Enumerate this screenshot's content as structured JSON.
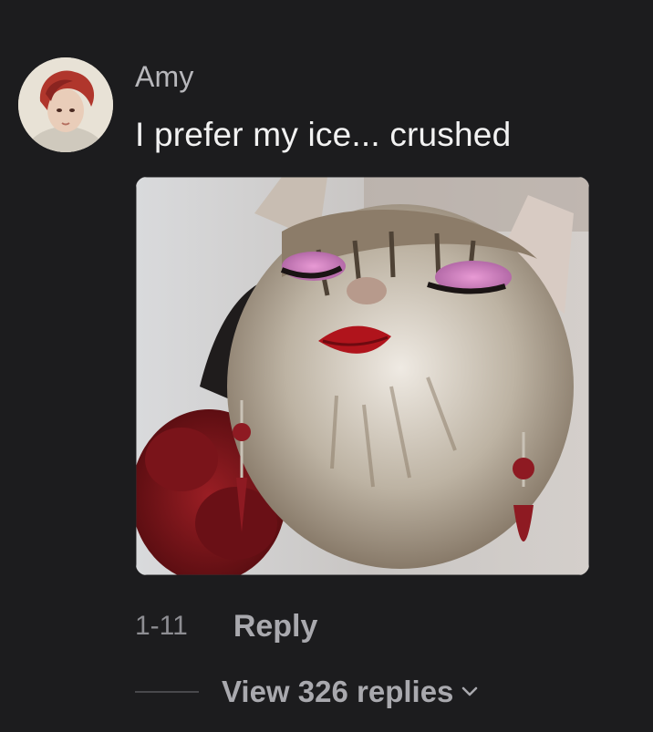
{
  "comment": {
    "username": "Amy",
    "text": "I prefer my ice... crushed",
    "date": "1-11",
    "reply_label": "Reply",
    "view_replies_label": "View 326 replies",
    "avatar_icon": "user-avatar-photo",
    "media_icon": "cat-with-makeup-photo",
    "chevron_icon": "chevron-down-icon"
  },
  "theme": {
    "background": "#1c1c1e",
    "text_primary": "#f2f2f2",
    "text_secondary": "#8e8e93"
  }
}
